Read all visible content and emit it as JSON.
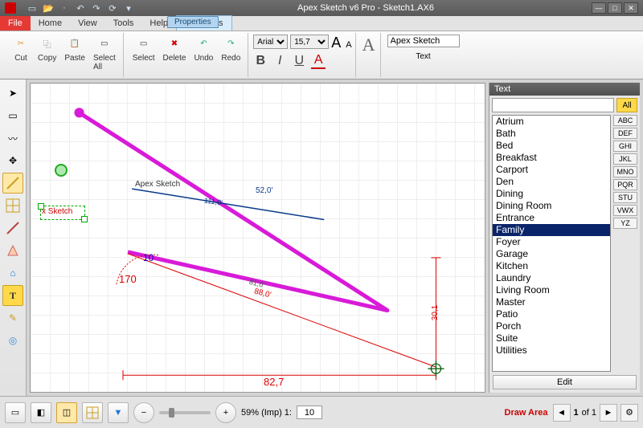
{
  "app": {
    "title": "Apex Sketch v6 Pro - Sketch1.AX6"
  },
  "menu": {
    "file": "File",
    "home": "Home",
    "view": "View",
    "tools": "Tools",
    "help": "Help",
    "edittools": "Edit Tools",
    "properties": "Properties"
  },
  "ribbon": {
    "cut": "Cut",
    "copy": "Copy",
    "paste": "Paste",
    "selectall": "Select\nAll",
    "select": "Select",
    "delete": "Delete",
    "undo": "Undo",
    "redo": "Redo",
    "font": "Arial",
    "size": "15,7",
    "text_label": "Text",
    "text_value": "Apex Sketch"
  },
  "canvas": {
    "selected_label": "x Sketch",
    "caption": "Apex Sketch",
    "measures": {
      "m1": "52,0'",
      "m2": "111,0'",
      "m3": "88,0'",
      "m4": "30,1",
      "m5": "82,7",
      "m6": "81,0'",
      "angle": "170",
      "small": "10"
    }
  },
  "sidepanel": {
    "title": "Text",
    "all": "All",
    "edit": "Edit",
    "items": [
      "Atrium",
      "Bath",
      "Bed",
      "Breakfast",
      "Carport",
      "Den",
      "Dining",
      "Dining Room",
      "Entrance",
      "Family",
      "Foyer",
      "Garage",
      "Kitchen",
      "Laundry",
      "Living Room",
      "Master",
      "Patio",
      "Porch",
      "Suite",
      "Utilities"
    ],
    "selected": "Family",
    "az": [
      "ABC",
      "DEF",
      "GHI",
      "JKL",
      "MNO",
      "PQR",
      "STU",
      "VWX",
      "YZ"
    ]
  },
  "footer": {
    "zoom_label": "59% (Imp) 1:",
    "zoom_value": "10",
    "draw": "Draw Area",
    "page": "of 1",
    "page_cur": "1"
  },
  "chart_data": {
    "type": "diagram",
    "note": "Freehand sketch segments with dimension labels; not a data chart.",
    "segments": [
      {
        "color": "magenta",
        "label": null
      },
      {
        "color": "blue",
        "label": "52,0'"
      },
      {
        "color": "red",
        "labels": [
          "88,0'",
          "30,1",
          "82,7"
        ],
        "angle": 170
      }
    ]
  }
}
